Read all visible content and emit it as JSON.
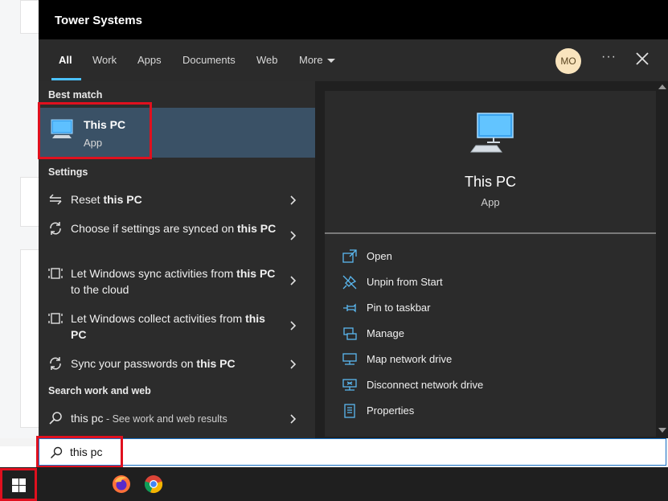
{
  "window": {
    "title": "Tower Systems"
  },
  "tabs": [
    {
      "label": "All",
      "active": true
    },
    {
      "label": "Work"
    },
    {
      "label": "Apps"
    },
    {
      "label": "Documents"
    },
    {
      "label": "Web"
    },
    {
      "label": "More"
    }
  ],
  "user": {
    "initials": "MO"
  },
  "header_icons": {
    "more": "more-options-icon",
    "close": "close-icon"
  },
  "results": {
    "best_match_label": "Best match",
    "best_match": {
      "name": "This PC",
      "type": "App",
      "icon": "computer-icon"
    },
    "settings_label": "Settings",
    "settings": [
      {
        "pre": "Reset ",
        "bold": "this PC",
        "post": "",
        "icon": "reset-icon"
      },
      {
        "pre": "Choose if settings are synced on ",
        "bold": "this PC",
        "post": "",
        "icon": "sync-icon"
      },
      {
        "pre": "Let Windows sync activities from ",
        "bold": "this PC",
        "post": " to the cloud",
        "icon": "activity-icon"
      },
      {
        "pre": "Let Windows collect activities from ",
        "bold": "this PC",
        "post": "",
        "icon": "activity-icon"
      },
      {
        "pre": "Sync your passwords on ",
        "bold": "this PC",
        "post": "",
        "icon": "sync-icon"
      }
    ],
    "web_label": "Search work and web",
    "web": {
      "query": "this pc",
      "suffix": " - See work and web results",
      "icon": "search-icon"
    }
  },
  "detail": {
    "name": "This PC",
    "type": "App",
    "actions": [
      {
        "label": "Open",
        "icon": "open-icon"
      },
      {
        "label": "Unpin from Start",
        "icon": "unpin-icon"
      },
      {
        "label": "Pin to taskbar",
        "icon": "pin-icon"
      },
      {
        "label": "Manage",
        "icon": "manage-icon"
      },
      {
        "label": "Map network drive",
        "icon": "network-drive-icon"
      },
      {
        "label": "Disconnect network drive",
        "icon": "disconnect-drive-icon"
      },
      {
        "label": "Properties",
        "icon": "properties-icon"
      }
    ]
  },
  "search": {
    "value": "this pc"
  },
  "taskbar": {
    "icons": [
      "windows-start-icon",
      "firefox-icon",
      "chrome-icon"
    ]
  },
  "colors": {
    "accent": "#4cc2ff",
    "highlight": "#e0101e",
    "selected": "#3a5166"
  }
}
